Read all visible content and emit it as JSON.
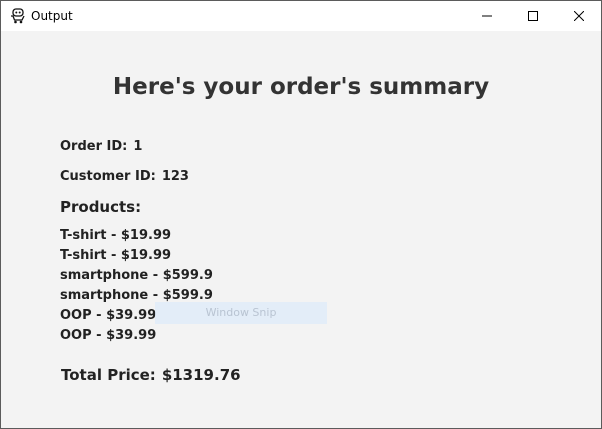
{
  "window": {
    "title": "Output",
    "app_icon": "robot-cart-icon",
    "controls": {
      "minimize_icon": "minimize-icon",
      "maximize_icon": "maximize-icon",
      "close_icon": "close-icon"
    }
  },
  "summary": {
    "heading": "Here's your order's summary",
    "order_id_label": "Order ID:",
    "order_id_value": "1",
    "customer_id_label": "Customer ID:",
    "customer_id_value": "123",
    "products_label": "Products:",
    "products": [
      "T-shirt - $19.99",
      "T-shirt - $19.99",
      "smartphone - $599.9",
      "smartphone - $599.9",
      "OOP - $39.99",
      "OOP - $39.99"
    ],
    "total_label": "Total Price:",
    "total_value": "$1319.76"
  },
  "overlay": {
    "text": "Window Snip"
  }
}
